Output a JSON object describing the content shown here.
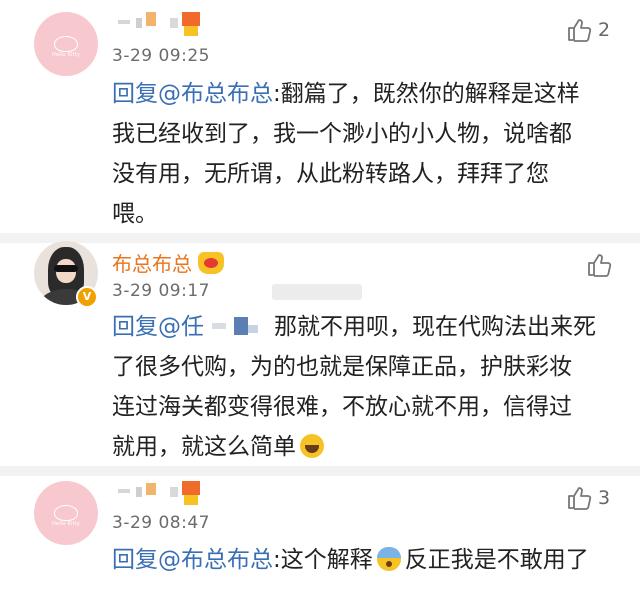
{
  "comments": [
    {
      "avatar": "hello-kitty-avatar",
      "avatar_text": "Hello Kitty",
      "username_redacted": true,
      "time": "3-29 09:25",
      "likes": "2",
      "body_mention": "回复@布总布总",
      "body_lines": [
        ":翻篇了，既然你的解释是这样",
        "我已经收到了，我一个渺小的小人物，说啥都",
        "没有用，无所谓，从此粉转路人，拜拜了您",
        "喂。"
      ]
    },
    {
      "avatar": "photo-avatar",
      "verified_badge": "V",
      "username": "布总布总",
      "time": "3-29 09:17",
      "likes": "",
      "body_mention": "回复@任",
      "body_after_redaction": "那就不用呗，现在代购法出来死",
      "body_lines": [
        "了很多代购，为的也就是保障正品，护肤彩妆",
        "连过海关都变得很难，不放心就不用，信得过",
        "就用，就这么简单"
      ],
      "emoji": "laughing-emoji"
    },
    {
      "avatar": "hello-kitty-avatar",
      "avatar_text": "Hello Kitty",
      "username_redacted": true,
      "time": "3-29 08:47",
      "likes": "3",
      "body_mention": "回复@布总布总",
      "body_text": ":这个解释",
      "body_after_emoji": "反正我是不敢用了",
      "emoji": "fearful-emoji"
    }
  ],
  "colors": {
    "username": "#e8761f",
    "mention": "#3a6fb5",
    "divider": "#f2f2f2",
    "avatar_pink": "#f7c9cf"
  }
}
